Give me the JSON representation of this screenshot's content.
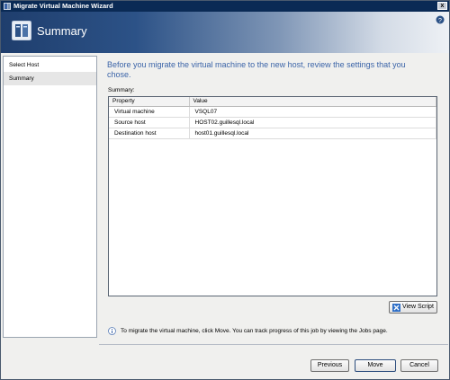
{
  "window": {
    "title": "Migrate Virtual Machine Wizard",
    "close_glyph": "x"
  },
  "header": {
    "title": "Summary",
    "help_glyph": "?"
  },
  "sidebar": {
    "items": [
      {
        "label": "Select Host",
        "selected": false
      },
      {
        "label": "Summary",
        "selected": true
      }
    ]
  },
  "main": {
    "intro": "Before you migrate the virtual machine to the new host, review the settings that you chose.",
    "summary_label": "Summary:",
    "table": {
      "columns": [
        "Property",
        "Value"
      ],
      "rows": [
        [
          "Virtual machine",
          "VSQL07"
        ],
        [
          "Source host",
          "HOST02.guillesql.local"
        ],
        [
          "Destination host",
          "host01.guillesql.local"
        ]
      ]
    },
    "view_script_label": "View Script",
    "info_text": "To migrate the virtual machine, click Move. You can track progress of this job by viewing the Jobs page."
  },
  "footer": {
    "previous_label": "Previous",
    "move_label": "Move",
    "cancel_label": "Cancel"
  },
  "colors": {
    "title_bar": "#0a2a55",
    "accent_text": "#3b64a8",
    "header_dark": "#1f3e6d"
  }
}
